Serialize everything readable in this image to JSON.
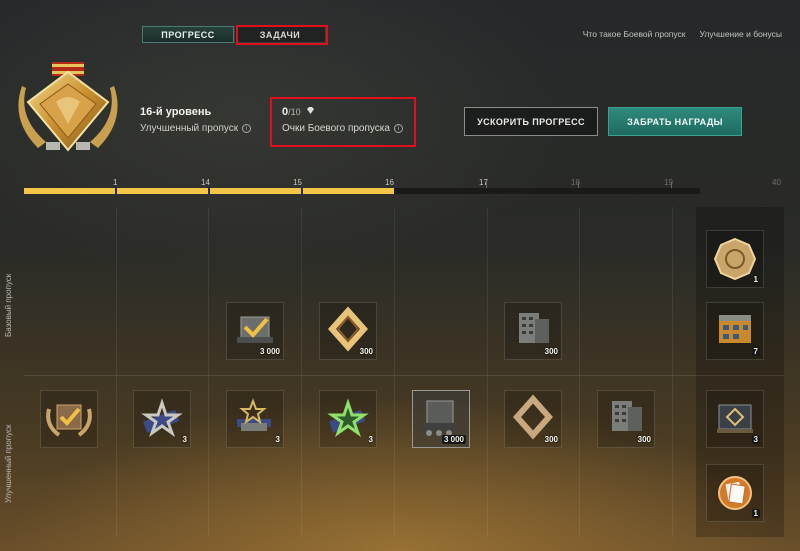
{
  "tabs": {
    "progress": "ПРОГРЕСС",
    "tasks": "ЗАДАЧИ"
  },
  "top_links": {
    "what_is": "Что такое Боевой пропуск",
    "upgrade": "Улучшение и бонусы"
  },
  "header": {
    "level": "16-й уровень",
    "pass_type": "Улучшенный пропуск",
    "points_value": "0",
    "points_total": "/10",
    "points_label": "Очки Боевого пропуска",
    "info_glyph": "i"
  },
  "buttons": {
    "speed_up": "УСКОРИТЬ ПРОГРЕСС",
    "claim": "ЗАБРАТЬ НАГРАДЫ"
  },
  "progress": {
    "ticks": [
      "1",
      "14",
      "15",
      "16",
      "17",
      "18",
      "19",
      "40"
    ],
    "current_level": 16
  },
  "rows": {
    "base": "Базовый пропуск",
    "improved": "Улучшенный пропуск"
  },
  "rewards": {
    "base": [
      {
        "icon": "tank-checkmark-icon",
        "count": "3 000"
      },
      {
        "icon": "diamond-frame-icon",
        "count": "300"
      },
      {
        "icon": "building-icon",
        "count": "300"
      },
      {
        "icon": "coin-icon",
        "count": "1"
      },
      {
        "icon": "warehouse-icon",
        "count": "7"
      }
    ],
    "improved": [
      {
        "icon": "laurel-badge-icon",
        "count": ""
      },
      {
        "icon": "star-blue-icon",
        "count": "3"
      },
      {
        "icon": "star-stack-icon",
        "count": "3"
      },
      {
        "icon": "star-green-icon",
        "count": "3"
      },
      {
        "icon": "tank-gray-icon",
        "count": "3 000"
      },
      {
        "icon": "diamond-frame-icon",
        "count": "300"
      },
      {
        "icon": "building-icon",
        "count": "300"
      },
      {
        "icon": "crate-icon",
        "count": "3"
      },
      {
        "icon": "card-pack-icon",
        "count": "1"
      }
    ]
  },
  "colors": {
    "accent_gold": "#f3c64a",
    "claim_teal": "#2f8a7d",
    "highlight_red": "#e00f1c"
  }
}
